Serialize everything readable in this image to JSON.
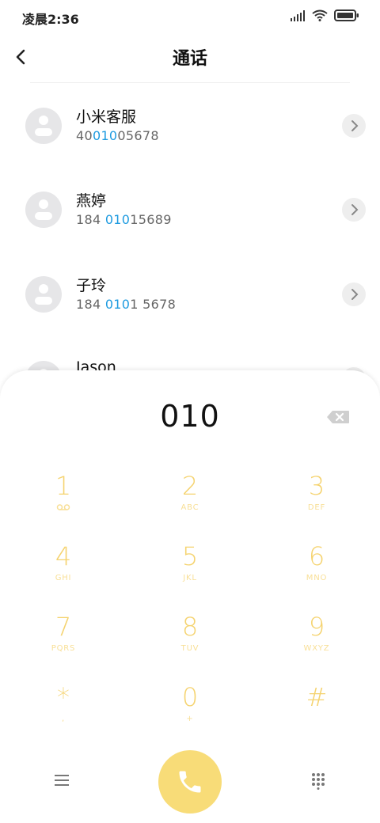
{
  "status_bar": {
    "time": "凌晨2:36"
  },
  "header": {
    "title": "通话"
  },
  "contacts": [
    {
      "name": "小米客服",
      "number_pre": "40",
      "number_hl": "010",
      "number_post": "05678"
    },
    {
      "name": "燕婷",
      "number_pre": "184 ",
      "number_hl": "010",
      "number_post": "15689"
    },
    {
      "name": "子玲",
      "number_pre": "184 ",
      "number_hl": "010",
      "number_post": "1 5678"
    },
    {
      "name": "Jason",
      "number_pre": "",
      "number_hl": "",
      "number_post": ""
    }
  ],
  "dialer": {
    "input": "010",
    "keys": [
      {
        "digit": "1",
        "letters": ""
      },
      {
        "digit": "2",
        "letters": "ABC"
      },
      {
        "digit": "3",
        "letters": "DEF"
      },
      {
        "digit": "4",
        "letters": "GHI"
      },
      {
        "digit": "5",
        "letters": "JKL"
      },
      {
        "digit": "6",
        "letters": "MNO"
      },
      {
        "digit": "7",
        "letters": "PQRS"
      },
      {
        "digit": "8",
        "letters": "TUV"
      },
      {
        "digit": "9",
        "letters": "WXYZ"
      },
      {
        "digit": "*",
        "letters": ","
      },
      {
        "digit": "0",
        "letters": "+"
      },
      {
        "digit": "#",
        "letters": ""
      }
    ]
  },
  "colors": {
    "accent_yellow": "#f8dc78",
    "highlight_blue": "#1e9be0"
  },
  "icons": [
    "back-icon",
    "signal-icon",
    "wifi-icon",
    "battery-icon",
    "chevron-right-icon",
    "backspace-icon",
    "voicemail-icon",
    "menu-icon",
    "phone-icon",
    "keypad-icon"
  ]
}
